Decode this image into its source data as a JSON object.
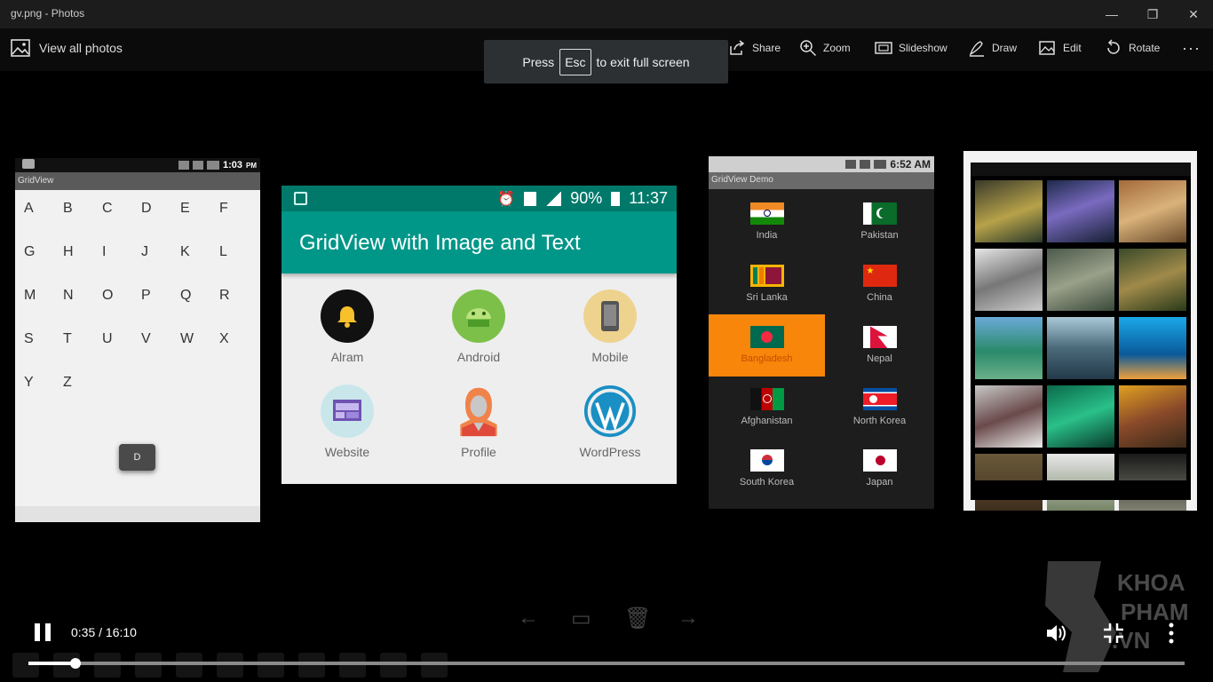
{
  "window": {
    "title": "gv.png - Photos",
    "minimize": "—",
    "maximize": "❐",
    "close": "✕"
  },
  "toolbar": {
    "view_all": "View all photos",
    "share": "Share",
    "zoom": "Zoom",
    "slideshow": "Slideshow",
    "draw": "Draw",
    "edit": "Edit",
    "rotate": "Rotate",
    "more": "···"
  },
  "toast": {
    "press": "Press",
    "key": "Esc",
    "rest": "to exit full screen"
  },
  "shot1": {
    "time": "1:03",
    "time_suffix": "PM",
    "title": "GridView",
    "letters": [
      "A",
      "B",
      "C",
      "D",
      "E",
      "F",
      "G",
      "H",
      "I",
      "J",
      "K",
      "L",
      "M",
      "N",
      "O",
      "P",
      "Q",
      "R",
      "S",
      "T",
      "U",
      "V",
      "W",
      "X",
      "Y",
      "Z"
    ],
    "popup": "D"
  },
  "shot2": {
    "battery": "90%",
    "time": "11:37",
    "title": "GridView with Image and Text",
    "items": [
      {
        "label": "Alram",
        "icon": "bell-icon"
      },
      {
        "label": "Android",
        "icon": "android-icon"
      },
      {
        "label": "Mobile",
        "icon": "mobile-icon"
      },
      {
        "label": "Website",
        "icon": "website-icon"
      },
      {
        "label": "Profile",
        "icon": "profile-icon"
      },
      {
        "label": "WordPress",
        "icon": "wordpress-icon"
      }
    ]
  },
  "shot3": {
    "time": "6:52 AM",
    "title": "GridView Demo",
    "selected": "Bangladesh",
    "countries": [
      "India",
      "Pakistan",
      "Sri Lanka",
      "China",
      "Bangladesh",
      "Nepal",
      "Afghanistan",
      "North Korea",
      "South Korea",
      "Japan"
    ]
  },
  "player": {
    "time_display": "0:35 / 16:10",
    "progress_fraction": 0.041
  },
  "watermark": {
    "line1": "KHOA",
    "line2": "PHAM",
    "line3": ".VN"
  },
  "colors": {
    "teal": "#009688",
    "teal_dark": "#00796b",
    "selected_orange": "#f7860a"
  }
}
